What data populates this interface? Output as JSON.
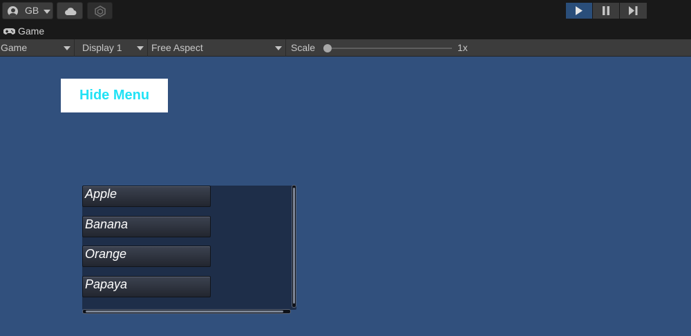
{
  "toolbar": {
    "account_label": "GB",
    "account_icon": "user-circle-icon",
    "cloud_icon": "cloud-icon",
    "collab_icon": "collab-hex-icon",
    "play_icon": "play-icon",
    "pause_icon": "pause-icon",
    "step_icon": "step-icon",
    "play_active_color": "#2a4e7a"
  },
  "tab": {
    "icon": "gamepad-icon",
    "label": "Game"
  },
  "game_toolbar": {
    "view_dropdown": "Game",
    "display_dropdown": "Display 1",
    "aspect_dropdown": "Free Aspect",
    "scale_label": "Scale",
    "scale_value": "1x",
    "scale_slider_level": 0
  },
  "game_view": {
    "background_color": "#31507d",
    "hide_menu_button": "Hide Menu",
    "hide_menu_text_color": "#22e2f5",
    "scroll_items": [
      "Apple",
      "Banana",
      "Orange",
      "Papaya"
    ]
  }
}
